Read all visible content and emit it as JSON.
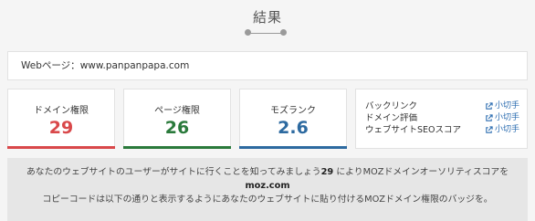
{
  "header": {
    "title": "結果"
  },
  "url_box": {
    "label": "Webページ：",
    "value": "www.panpanpapa.com"
  },
  "metrics": [
    {
      "label": "ドメイン権限",
      "value": "29",
      "color": "#d9484a"
    },
    {
      "label": "ページ権限",
      "value": "26",
      "color": "#2a7a3b"
    },
    {
      "label": "モズランク",
      "value": "2.6",
      "color": "#2d6aa0"
    }
  ],
  "links": [
    {
      "label": "バックリンク",
      "link_text": "小切手"
    },
    {
      "label": "ドメイン評価",
      "link_text": "小切手"
    },
    {
      "label": "ウェブサイトSEOスコア",
      "link_text": "小切手"
    }
  ],
  "note": {
    "part1": "あなたのウェブサイトのユーザーがサイトに行くことを知ってみましょう",
    "number": "29",
    "part2": "によりMOZドメインオーソリティスコアを",
    "site": "moz.com",
    "part3": "コピーコードは以下の通りと表示するようにあなたのウェブサイトに貼り付けるMOZドメイン権限のバッジを。"
  },
  "colors": {
    "link": "#2b6cb0",
    "slider": "#9a9a9a"
  }
}
